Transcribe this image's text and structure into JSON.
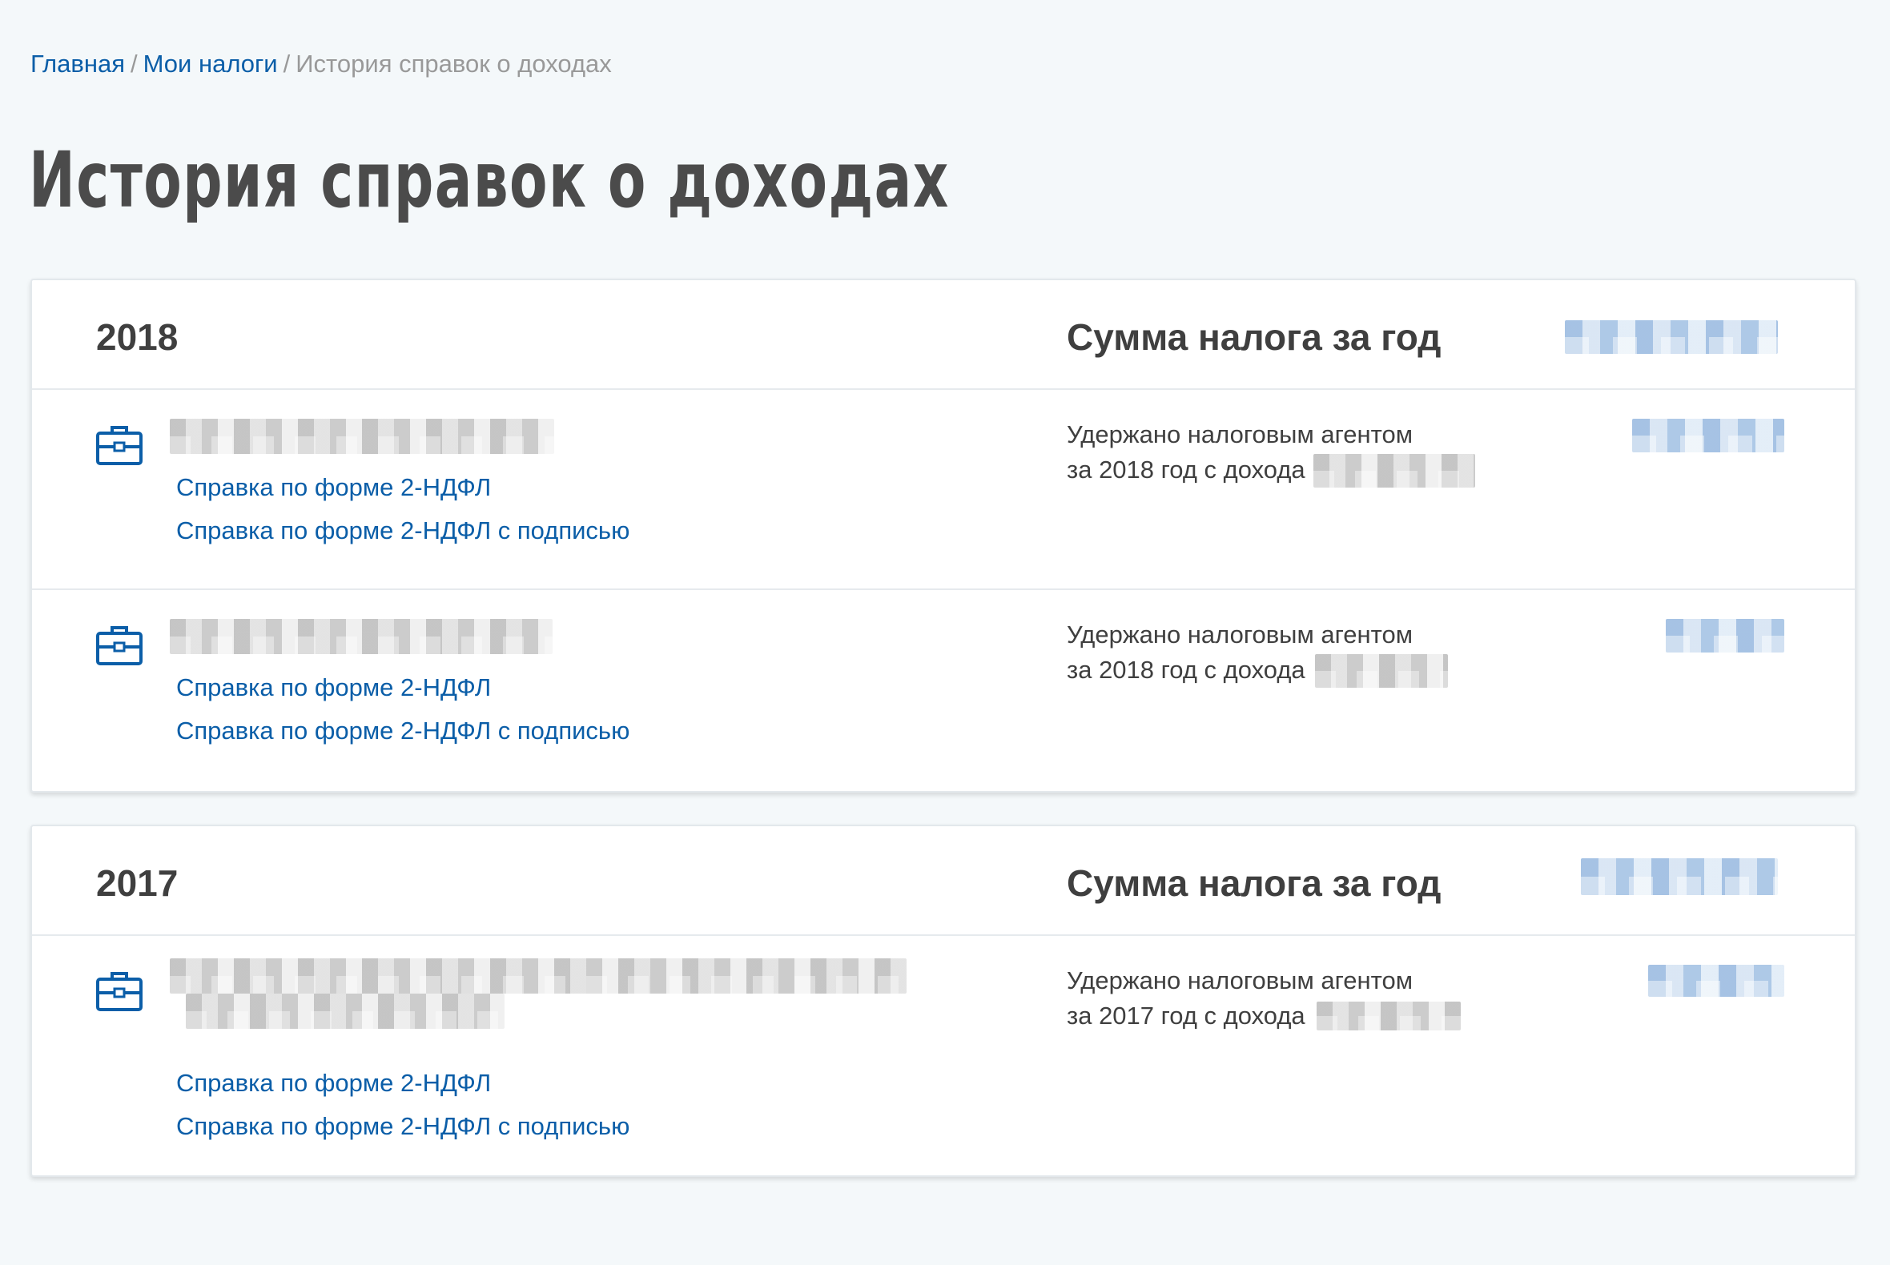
{
  "breadcrumb": {
    "home": "Главная",
    "taxes": "Мои налоги",
    "current": "История справок о доходах",
    "separator": "/"
  },
  "page_title": "История справок о доходах",
  "years": [
    {
      "year": "2018",
      "sum_label": "Сумма налога за год",
      "certificates": [
        {
          "link_2ndfl": "Справка по форме 2-НДФЛ",
          "link_2ndfl_signed": "Справка по форме 2-НДФЛ с подписью",
          "withheld_line1": "Удержано налоговым агентом",
          "withheld_line2": "за 2018 год с дохода"
        },
        {
          "link_2ndfl": "Справка по форме 2-НДФЛ",
          "link_2ndfl_signed": "Справка по форме 2-НДФЛ с подписью",
          "withheld_line1": "Удержано налоговым агентом",
          "withheld_line2": "за 2018 год с дохода"
        }
      ]
    },
    {
      "year": "2017",
      "sum_label": "Сумма налога за год",
      "certificates": [
        {
          "link_2ndfl": "Справка по форме 2-НДФЛ",
          "link_2ndfl_signed": "Справка по форме 2-НДФЛ с подписью",
          "withheld_line1": "Удержано налоговым агентом",
          "withheld_line2": "за 2017 год с дохода"
        }
      ]
    }
  ],
  "colors": {
    "link": "#0b5ea8",
    "background": "#f4f8fa",
    "card": "#ffffff",
    "text": "#3f3f3f",
    "muted": "#999999"
  },
  "icons": {
    "certificate": "briefcase-icon"
  }
}
